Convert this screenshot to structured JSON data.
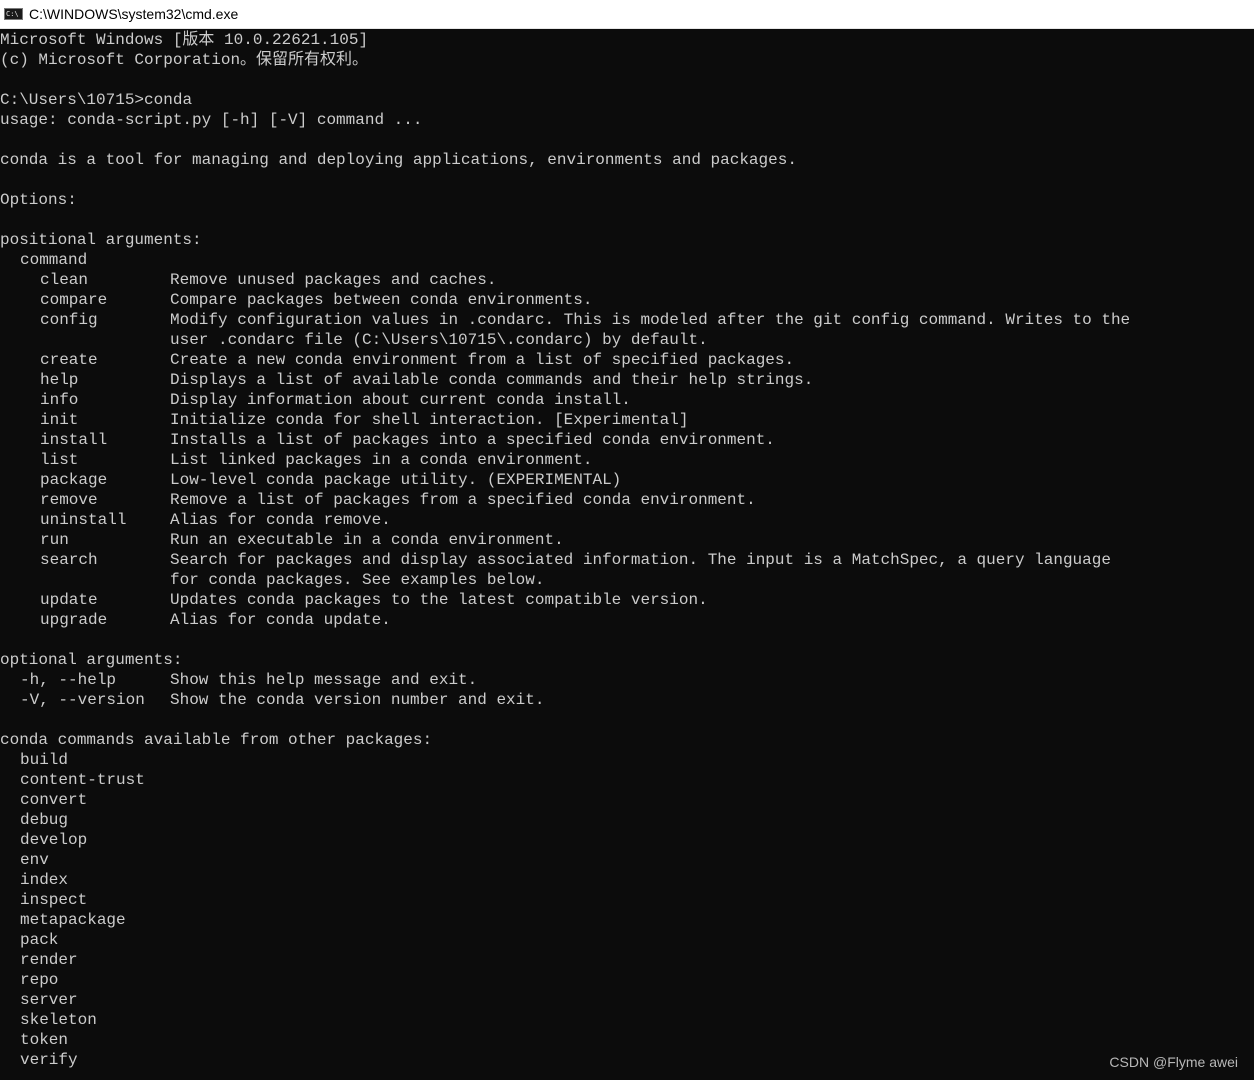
{
  "window": {
    "title": "C:\\WINDOWS\\system32\\cmd.exe",
    "icon": "cmd-console-icon",
    "icon_glyph": "C:\\"
  },
  "console": {
    "header": [
      "Microsoft Windows [版本 10.0.22621.105]",
      "(c) Microsoft Corporation。保留所有权利。"
    ],
    "prompt": "C:\\Users\\10715>",
    "command_typed": "conda",
    "usage": "usage: conda-script.py [-h] [-V] command ...",
    "description": "conda is a tool for managing and deploying applications, environments and packages.",
    "options_heading": "Options:",
    "positional_heading": "positional arguments:",
    "command_label": "command",
    "commands": [
      {
        "name": "clean",
        "desc": "Remove unused packages and caches."
      },
      {
        "name": "compare",
        "desc": "Compare packages between conda environments."
      },
      {
        "name": "config",
        "desc": "Modify configuration values in .condarc. This is modeled after the git config command. Writes to the",
        "desc2": "user .condarc file (C:\\Users\\10715\\.condarc) by default."
      },
      {
        "name": "create",
        "desc": "Create a new conda environment from a list of specified packages."
      },
      {
        "name": "help",
        "desc": "Displays a list of available conda commands and their help strings."
      },
      {
        "name": "info",
        "desc": "Display information about current conda install."
      },
      {
        "name": "init",
        "desc": "Initialize conda for shell interaction. [Experimental]"
      },
      {
        "name": "install",
        "desc": "Installs a list of packages into a specified conda environment."
      },
      {
        "name": "list",
        "desc": "List linked packages in a conda environment."
      },
      {
        "name": "package",
        "desc": "Low-level conda package utility. (EXPERIMENTAL)"
      },
      {
        "name": "remove",
        "desc": "Remove a list of packages from a specified conda environment."
      },
      {
        "name": "uninstall",
        "desc": "Alias for conda remove."
      },
      {
        "name": "run",
        "desc": "Run an executable in a conda environment."
      },
      {
        "name": "search",
        "desc": "Search for packages and display associated information. The input is a MatchSpec, a query language",
        "desc2": "for conda packages. See examples below."
      },
      {
        "name": "update",
        "desc": "Updates conda packages to the latest compatible version."
      },
      {
        "name": "upgrade",
        "desc": "Alias for conda update."
      }
    ],
    "optional_heading": "optional arguments:",
    "optional": [
      {
        "flag": "-h, --help",
        "desc": "Show this help message and exit."
      },
      {
        "flag": "-V, --version",
        "desc": "Show the conda version number and exit."
      }
    ],
    "other_heading": "conda commands available from other packages:",
    "other_packages": [
      "build",
      "content-trust",
      "convert",
      "debug",
      "develop",
      "env",
      "index",
      "inspect",
      "metapackage",
      "pack",
      "render",
      "repo",
      "server",
      "skeleton",
      "token",
      "verify"
    ]
  },
  "watermark": "CSDN @Flyme awei",
  "colors": {
    "console_bg": "#0c0c0c",
    "console_fg": "#cccccc",
    "titlebar_bg": "#ffffff"
  }
}
